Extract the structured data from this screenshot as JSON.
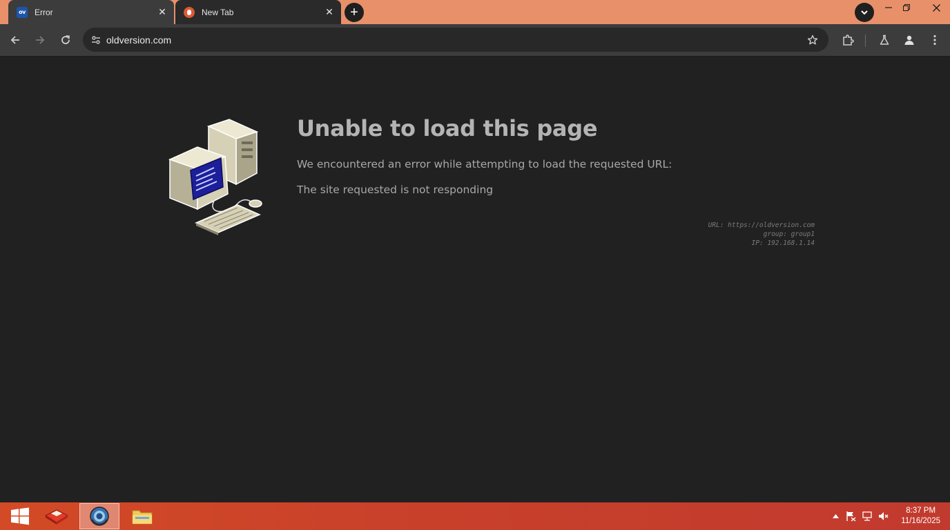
{
  "browser": {
    "tabs": [
      {
        "title": "Error",
        "favicon": "ov-favicon-icon",
        "favicon_text": "ov",
        "active": true
      },
      {
        "title": "New Tab",
        "favicon": "duckduckgo-favicon-icon",
        "active": false
      }
    ],
    "address_bar": {
      "url": "oldversion.com"
    }
  },
  "page": {
    "title": "Unable to load this page",
    "description": "We encountered an error while attempting to load the requested URL:",
    "reason": "The site requested is not responding",
    "meta": {
      "url_line": "URL: https://oldversion.com",
      "group_line": "group: group1",
      "ip_line": "IP: 192.168.1.14"
    }
  },
  "taskbar": {
    "items": [
      "start-button",
      "app-icon",
      "browser-icon",
      "file-explorer-icon"
    ],
    "clock": {
      "time": "8:37 PM",
      "date": "11/16/2025"
    }
  },
  "colors": {
    "tabstrip": "#e8906a",
    "toolbar": "#3c3c3c",
    "page_bg": "#212121",
    "taskbar": "#c9412a"
  }
}
